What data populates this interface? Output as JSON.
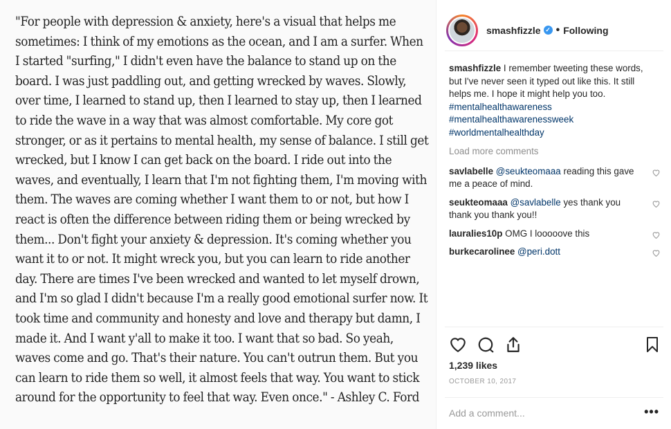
{
  "post": {
    "quote": "\"For people with depression & anxiety, here's a visual that helps me sometimes: I think of my emotions as the ocean, and I am a surfer. When I started \"surfing,\" I didn't even have the balance to stand up on the board. I was just paddling out, and getting wrecked by waves. Slowly, over time, I learned to stand up, then I learned to stay up, then I learned to ride the wave in a way that was almost comfortable. My core got stronger, or as it pertains to mental health, my sense of balance. I still get wrecked, but I know I can get back on the board. I ride out into the waves, and eventually, I learn that I'm not fighting them, I'm moving with them. The waves are coming whether I want them to or not, but how I react is often the difference between riding them or being wrecked by them... Don't fight your anxiety & depression. It's coming whether you want it to or not. It might wreck you, but you can learn to ride another day. There are times I've been wrecked and wanted to let myself drown, and I'm so glad I didn't because I'm a really good emotional surfer now. It took time and community and honesty and love and therapy but damn, I made it. And I want y'all to make it too. I want that so bad. So yeah, waves come and go. That's their nature. You can't outrun them. But you can learn to ride them so well, it almost feels that way. You want to stick around for the opportunity to feel that way. Even once.\" - Ashley C. Ford"
  },
  "header": {
    "username": "smashfizzle",
    "verified_mark": "✓",
    "separator": "•",
    "follow_status": "Following"
  },
  "caption": {
    "username": "smashfizzle",
    "text": " I remember tweeting these words, but I've never seen it typed out like this. It still helps me. I hope it might help you too. ",
    "hashtags": [
      "#mentalhealthawareness",
      "#mentalhealthawarenessweek",
      "#worldmentalhealthday"
    ]
  },
  "load_more": "Load more comments",
  "comments": [
    {
      "username": "savlabelle",
      "mention": "@seukteomaaa",
      "text": " reading this gave me a peace of mind."
    },
    {
      "username": "seukteomaaa",
      "mention": "@savlabelle",
      "text": " yes thank you thank you thank you!!"
    },
    {
      "username": "lauralies10p",
      "mention": "",
      "text": "OMG I looooove this"
    },
    {
      "username": "burkecarolinee",
      "mention": "@peri.dott",
      "text": ""
    }
  ],
  "likes": "1,239 likes",
  "date": "OCTOBER 10, 2017",
  "add_comment": {
    "placeholder": "Add a comment..."
  },
  "more_label": "•••",
  "icons": [
    "heart-icon",
    "comment-icon",
    "share-icon",
    "bookmark-icon",
    "more-icon"
  ]
}
